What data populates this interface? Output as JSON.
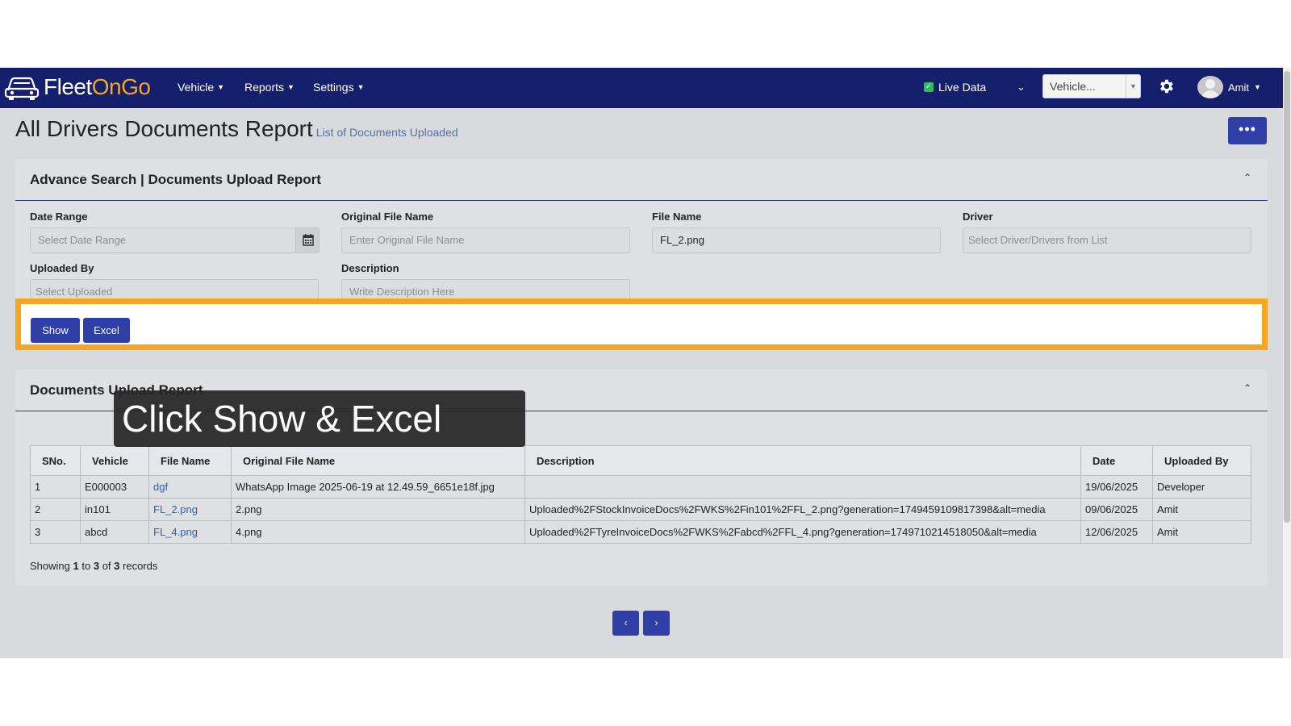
{
  "app": {
    "logo_text_1": "Fleet",
    "logo_text_2": "On",
    "logo_text_3": "G",
    "logo_text_4": "o"
  },
  "nav": {
    "menus": [
      {
        "label": "Vehicle"
      },
      {
        "label": "Reports"
      },
      {
        "label": "Settings"
      }
    ],
    "live_data_label": "Live Data",
    "vehicle_select_value": "Vehicle...",
    "user_name": "Amit"
  },
  "page": {
    "title": "All Drivers Documents Report",
    "subtitle": "List of Documents Uploaded"
  },
  "search": {
    "title": "Advance Search | Documents Upload Report",
    "date_range": {
      "label": "Date Range",
      "placeholder": "Select Date Range"
    },
    "original_file_name": {
      "label": "Original File Name",
      "placeholder": "Enter Original File Name"
    },
    "file_name": {
      "label": "File Name",
      "value": "FL_2.png"
    },
    "driver": {
      "label": "Driver",
      "placeholder": "Select Driver/Drivers from List"
    },
    "uploaded_by": {
      "label": "Uploaded By",
      "placeholder": "Select Uploaded"
    },
    "description": {
      "label": "Description",
      "placeholder": "Write Description Here"
    },
    "show_label": "Show",
    "excel_label": "Excel"
  },
  "results": {
    "title": "Documents Upload Report",
    "columns": [
      "SNo.",
      "Vehicle",
      "File Name",
      "Original File Name",
      "Description",
      "Date",
      "Uploaded By"
    ],
    "rows": [
      {
        "sno": "1",
        "vehicle": "E000003",
        "file_name": "dgf",
        "original": "WhatsApp Image 2025-06-19 at 12.49.59_6651e18f.jpg",
        "description": "",
        "date": "19/06/2025",
        "uploaded_by": "Developer"
      },
      {
        "sno": "2",
        "vehicle": "in101",
        "file_name": "FL_2.png",
        "original": "2.png",
        "description": "Uploaded%2FStockInvoiceDocs%2FWKS%2Fin101%2FFL_2.png?generation=1749459109817398&alt=media",
        "date": "09/06/2025",
        "uploaded_by": "Amit"
      },
      {
        "sno": "3",
        "vehicle": "abcd",
        "file_name": "FL_4.png",
        "original": "4.png",
        "description": "Uploaded%2FTyreInvoiceDocs%2FWKS%2Fabcd%2FFL_4.png?generation=1749710214518050&alt=media",
        "date": "12/06/2025",
        "uploaded_by": "Amit"
      }
    ],
    "showing_prefix": "Showing",
    "showing_from": "1",
    "showing_to_word": "to",
    "showing_to": "3",
    "showing_of_word": "of",
    "showing_total": "3",
    "showing_suffix": "records"
  },
  "pager": {
    "prev": "‹",
    "next": "›"
  },
  "tooltip": {
    "text": "Click Show & Excel"
  },
  "colors": {
    "navbar": "#14206b",
    "primary": "#2f3fa6",
    "highlight": "#f5a623",
    "link": "#2a63b8"
  }
}
